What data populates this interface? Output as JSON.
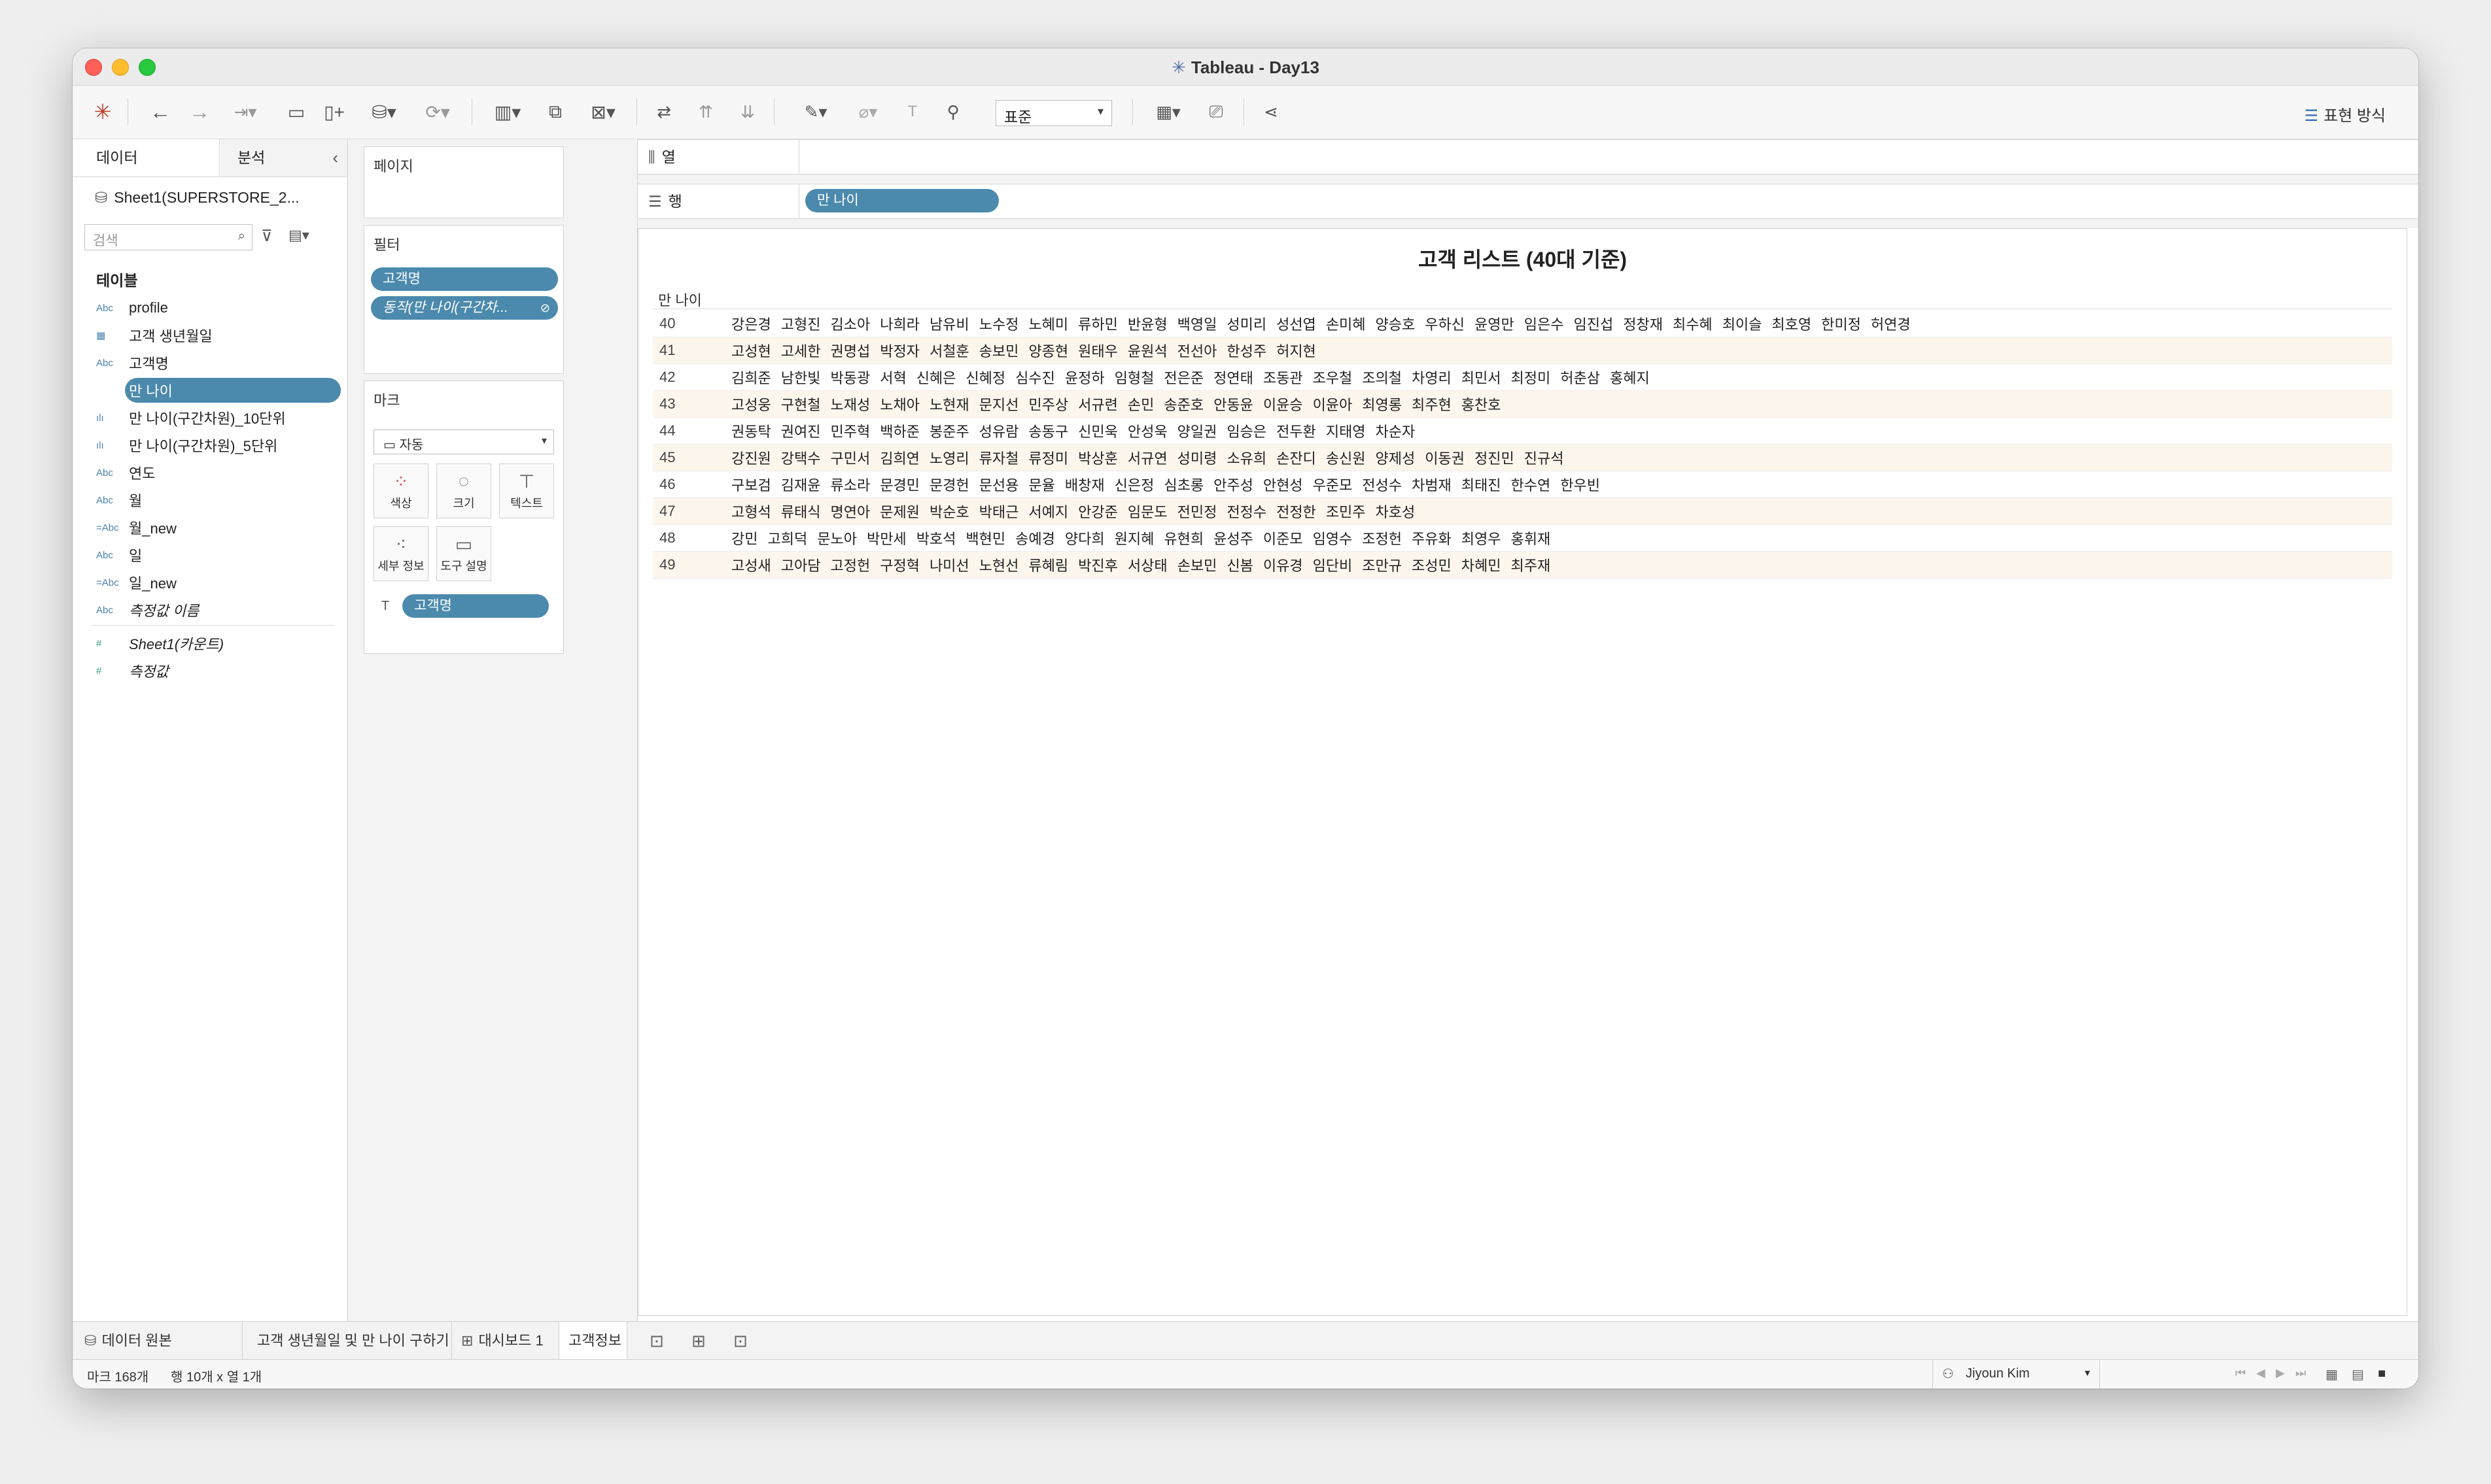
{
  "window": {
    "title": "Tableau - Day13"
  },
  "toolbar": {
    "standard_select": "표준",
    "show_me": "표현 방식"
  },
  "data_pane": {
    "tab_data": "데이터",
    "tab_analysis": "분석",
    "datasource": "Sheet1(SUPERSTORE_2...",
    "search_placeholder": "검색",
    "tables_header": "테이블",
    "fields": [
      {
        "type_icon": "Abc",
        "name": "profile"
      },
      {
        "type_icon": "date",
        "name": "고객 생년월일"
      },
      {
        "type_icon": "Abc",
        "name": "고객명"
      },
      {
        "type_icon": "#",
        "name": "만 나이"
      },
      {
        "type_icon": "bin",
        "name": "만 나이(구간차원)_10단위"
      },
      {
        "type_icon": "bin",
        "name": "만 나이(구간차원)_5단위"
      },
      {
        "type_icon": "Abc",
        "name": "연도"
      },
      {
        "type_icon": "Abc",
        "name": "월"
      },
      {
        "type_icon": "=Abc",
        "name": "월_new"
      },
      {
        "type_icon": "Abc",
        "name": "일"
      },
      {
        "type_icon": "=Abc",
        "name": "일_new"
      },
      {
        "type_icon": "Abc",
        "name": "측정값 이름"
      }
    ],
    "measures": [
      {
        "type_icon": "#",
        "name": "Sheet1(카운트)"
      },
      {
        "type_icon": "#",
        "name": "측정값"
      }
    ]
  },
  "cards": {
    "pages": "페이지",
    "filters": "필터",
    "filter_pills": [
      "고객명",
      "동작(만 나이(구간차..."
    ],
    "marks": "마크",
    "mark_type": "자동",
    "mark_buttons": [
      "색상",
      "크기",
      "텍스트",
      "세부 정보",
      "도구 설명"
    ],
    "mark_pill": "고객명"
  },
  "shelves": {
    "columns": "열",
    "rows": "행",
    "rows_pill": "만 나이"
  },
  "viz": {
    "title": "고객 리스트 (40대 기준)",
    "column_header": "만 나이",
    "rows": [
      {
        "age": "40",
        "names": [
          "강은경",
          "고형진",
          "김소아",
          "나희라",
          "남유비",
          "노수정",
          "노혜미",
          "류하민",
          "반윤형",
          "백영일",
          "성미리",
          "성선엽",
          "손미혜",
          "양승호",
          "우하신",
          "윤영만",
          "임은수",
          "임진섭",
          "정창재",
          "최수혜",
          "최이슬",
          "최호영",
          "한미정",
          "허연경"
        ]
      },
      {
        "age": "41",
        "names": [
          "고성현",
          "고세한",
          "권명섭",
          "박정자",
          "서철훈",
          "송보민",
          "양종현",
          "원태우",
          "윤원석",
          "전선아",
          "한성주",
          "허지현"
        ]
      },
      {
        "age": "42",
        "names": [
          "김희준",
          "남한빛",
          "박동광",
          "서혁",
          "신혜은",
          "신혜정",
          "심수진",
          "윤정하",
          "임형철",
          "전은준",
          "정연태",
          "조동관",
          "조우철",
          "조의철",
          "차영리",
          "최민서",
          "최정미",
          "허춘삼",
          "홍혜지"
        ]
      },
      {
        "age": "43",
        "names": [
          "고성웅",
          "구현철",
          "노재성",
          "노채아",
          "노현재",
          "문지선",
          "민주상",
          "서규련",
          "손민",
          "송준호",
          "안동윤",
          "이윤승",
          "이윤아",
          "최영롱",
          "최주현",
          "홍찬호"
        ]
      },
      {
        "age": "44",
        "names": [
          "권동탁",
          "권여진",
          "민주혁",
          "백하준",
          "봉준주",
          "성유람",
          "송동구",
          "신민욱",
          "안성욱",
          "양일권",
          "임승은",
          "전두환",
          "지태영",
          "차순자"
        ]
      },
      {
        "age": "45",
        "names": [
          "강진원",
          "강택수",
          "구민서",
          "김희연",
          "노영리",
          "류자철",
          "류정미",
          "박상훈",
          "서규연",
          "성미령",
          "소유희",
          "손잔디",
          "송신원",
          "양제성",
          "이동권",
          "정진민",
          "진규석"
        ]
      },
      {
        "age": "46",
        "names": [
          "구보검",
          "김재윤",
          "류소라",
          "문경민",
          "문경헌",
          "문선용",
          "문율",
          "배창재",
          "신은정",
          "심초롱",
          "안주성",
          "안현성",
          "우준모",
          "전성수",
          "차범재",
          "최태진",
          "한수연",
          "한우빈"
        ]
      },
      {
        "age": "47",
        "names": [
          "고형석",
          "류태식",
          "명연아",
          "문제원",
          "박순호",
          "박태근",
          "서예지",
          "안강준",
          "임문도",
          "전민정",
          "전정수",
          "전정한",
          "조민주",
          "차호성"
        ]
      },
      {
        "age": "48",
        "names": [
          "강민",
          "고희덕",
          "문노아",
          "박만세",
          "박호석",
          "백현민",
          "송예경",
          "양다희",
          "원지혜",
          "유현희",
          "윤성주",
          "이준모",
          "임영수",
          "조정헌",
          "주유화",
          "최영우",
          "홍휘재"
        ]
      },
      {
        "age": "49",
        "names": [
          "고성새",
          "고아담",
          "고정헌",
          "구정혁",
          "나미선",
          "노현선",
          "류혜림",
          "박진후",
          "서상태",
          "손보민",
          "신봄",
          "이유경",
          "임단비",
          "조만규",
          "조성민",
          "차혜민",
          "최주재"
        ]
      }
    ]
  },
  "sheet_tabs": [
    "데이터 원본",
    "고객 생년월일 및 만 나이 구하기",
    "대시보드 1",
    "고객정보"
  ],
  "status": {
    "marks": "마크 168개",
    "rowcol": "행 10개 x 열 1개",
    "user": "Jiyoun Kim"
  }
}
